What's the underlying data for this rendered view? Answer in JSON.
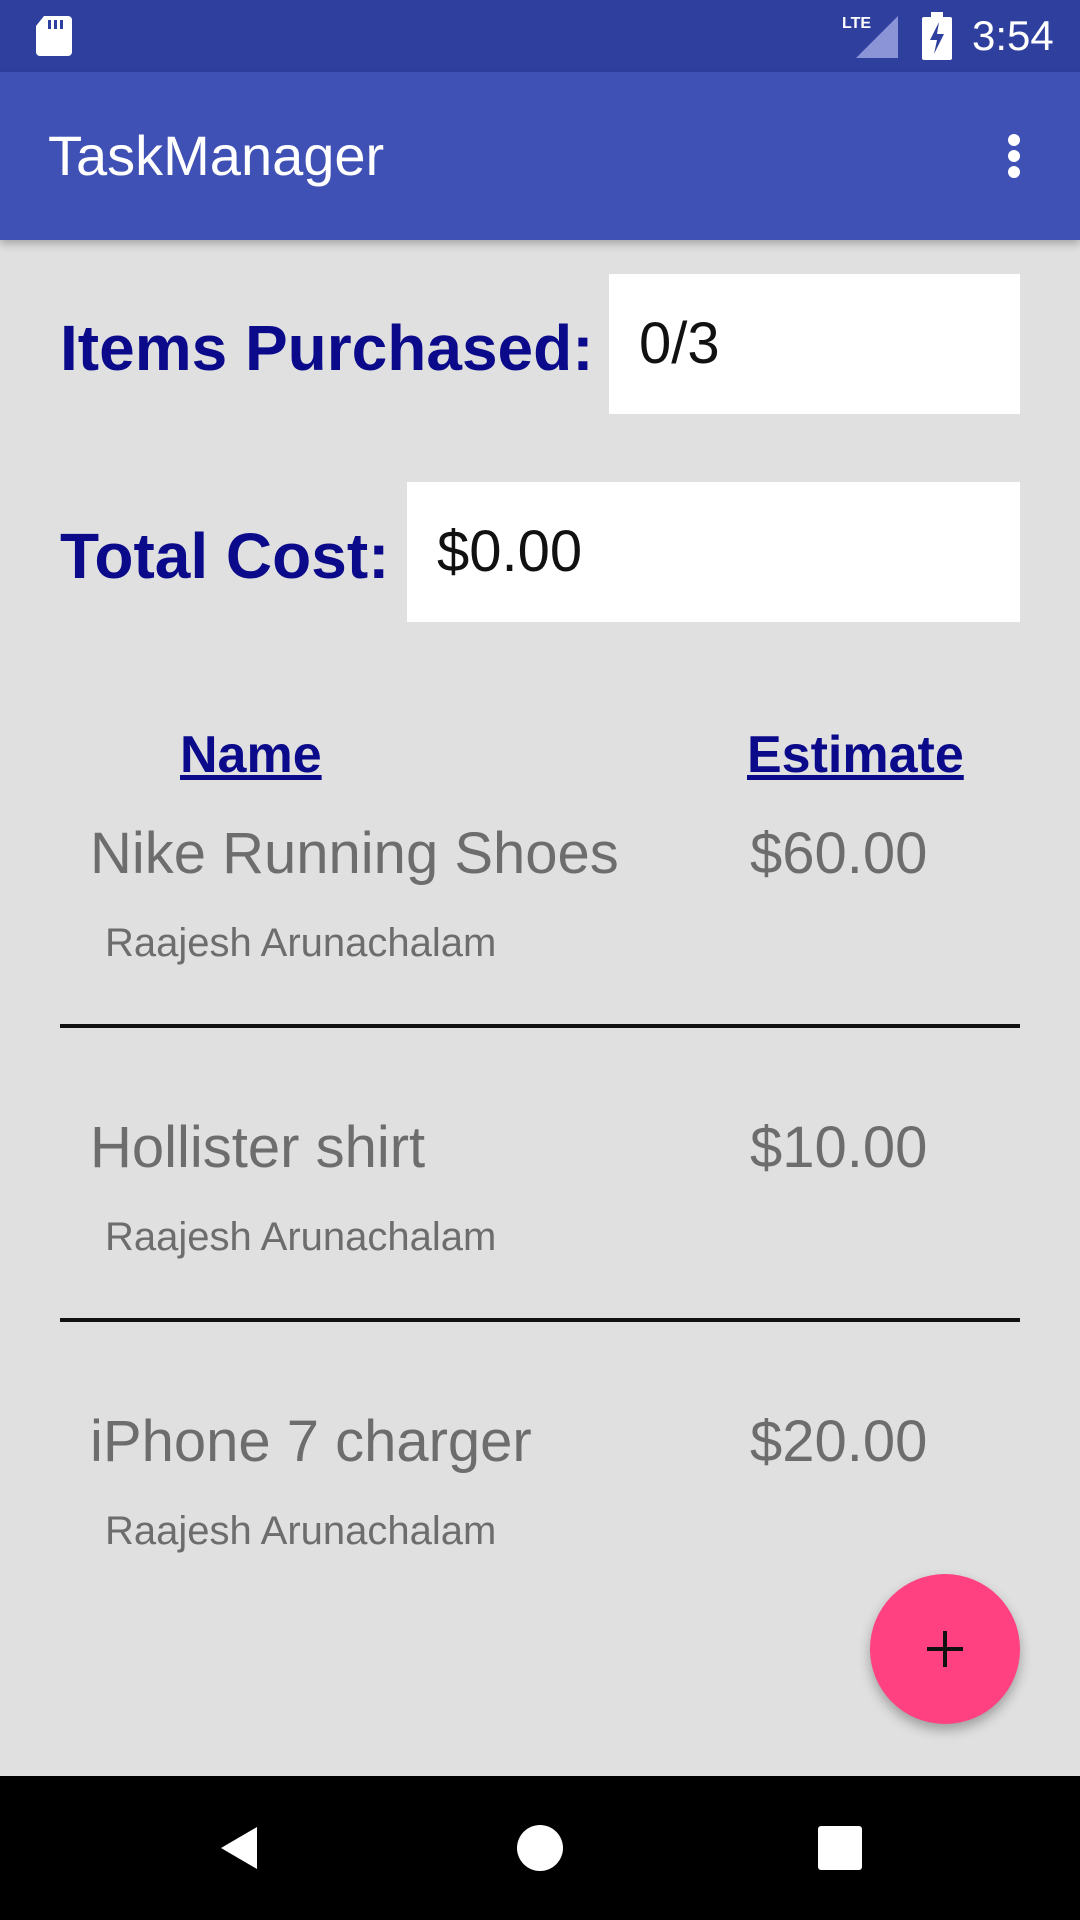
{
  "status_bar": {
    "time": "3:54",
    "network_label": "LTE",
    "icons": [
      "sd-card-icon",
      "signal-icon",
      "battery-charging-icon"
    ]
  },
  "app_bar": {
    "title": "TaskManager",
    "menu_icon": "more-vert-icon"
  },
  "summary": {
    "items_label": "Items Purchased:",
    "items_value": "0/3",
    "cost_label": "Total Cost:",
    "cost_value": "$0.00"
  },
  "columns": {
    "name": "Name",
    "estimate": "Estimate"
  },
  "tasks": [
    {
      "name": "Nike Running Shoes",
      "estimate": "$60.00",
      "assignee": "Raajesh Arunachalam"
    },
    {
      "name": "Hollister shirt",
      "estimate": "$10.00",
      "assignee": "Raajesh Arunachalam"
    },
    {
      "name": "iPhone 7 charger",
      "estimate": "$20.00",
      "assignee": "Raajesh Arunachalam"
    }
  ],
  "fab": {
    "icon": "add-icon",
    "label": "+"
  },
  "nav": {
    "back_icon": "back-icon",
    "home_icon": "home-icon",
    "recents_icon": "recents-icon"
  },
  "colors": {
    "status_bar": "#2f3f9e",
    "app_bar": "#3f51b5",
    "background": "#e0e0e0",
    "label_blue": "#0a0a8a",
    "fab": "#ff4081",
    "text_gray": "#6d6d6d"
  }
}
